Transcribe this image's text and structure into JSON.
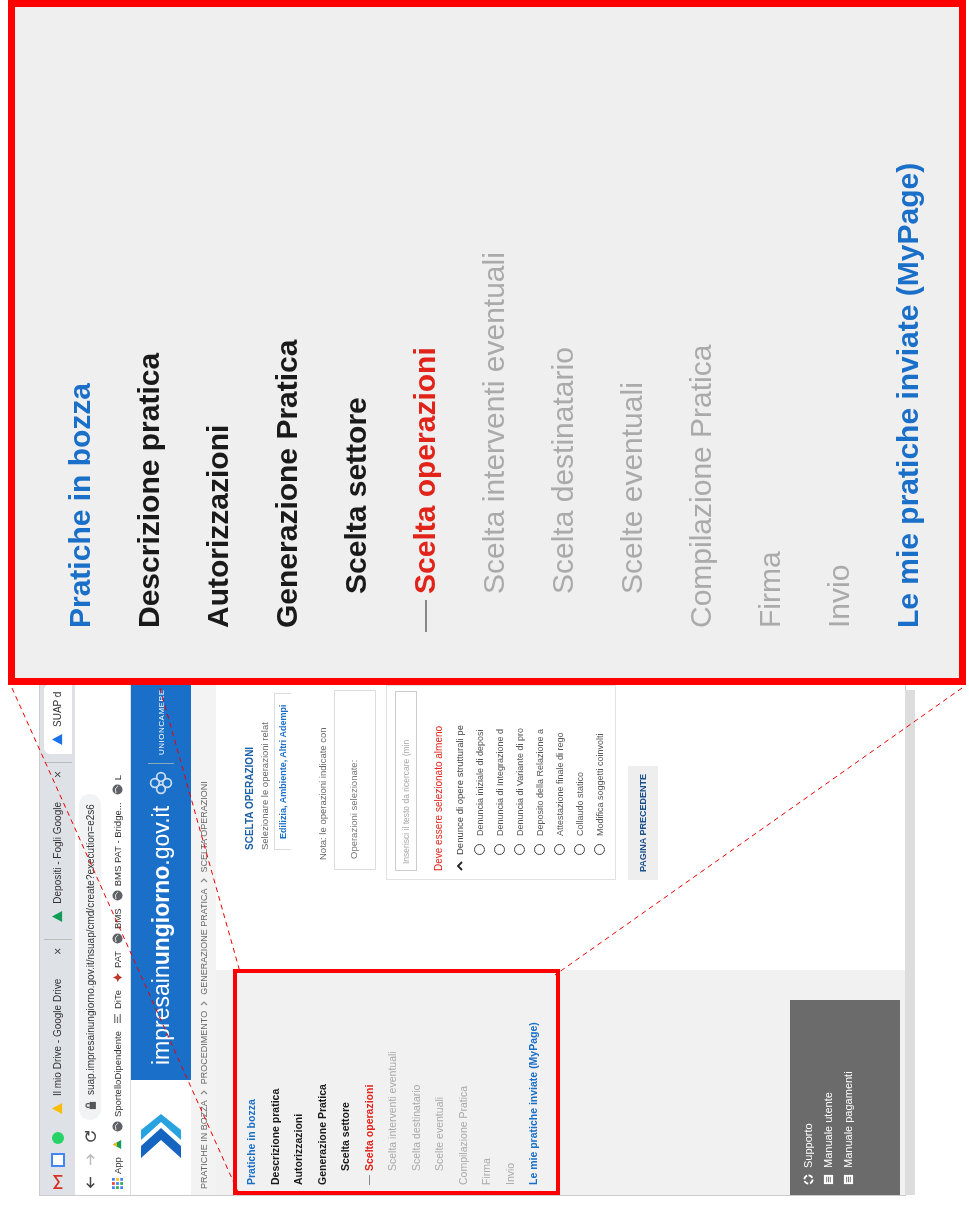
{
  "browser": {
    "tabs": [
      {
        "title": "Il mio Drive - Google Drive",
        "close": "×",
        "selected": false
      },
      {
        "title": "Depositi - Fogli Google",
        "close": "×",
        "selected": false
      },
      {
        "title": "SUAP d",
        "selected": true
      }
    ],
    "address": "suap.impresainungiorno.gov.it/nsuap/cmd/create?execution=e2s6",
    "bookmarks": [
      {
        "label": "App",
        "kind": "apps"
      },
      {
        "kind": "drive"
      },
      {
        "label": "SportelloDipendente",
        "kind": "globe"
      },
      {
        "label": "DiTe",
        "kind": "lines"
      },
      {
        "label": "PAT",
        "kind": "pat"
      },
      {
        "label": "BMS",
        "kind": "globe"
      },
      {
        "label": "BMS PAT - Bridge...",
        "kind": "globe"
      },
      {
        "label": "L",
        "kind": "globe"
      }
    ]
  },
  "header": {
    "site_name": "impresain**ungiorno**.gov.it",
    "partner": "UNIONCAMERE"
  },
  "breadcrumb": [
    "PRATICHE IN BOZZA",
    "PROCEDIMENTO",
    "GENERAZIONE PRATICA",
    "SCELTA OPERAZIONI"
  ],
  "sidebar": {
    "items": [
      {
        "label": "Pratiche in bozza",
        "kind": "link"
      },
      {
        "label": "Descrizione pratica",
        "kind": "step",
        "selected": false,
        "disabled": false
      },
      {
        "label": "Autorizzazioni",
        "kind": "step",
        "selected": false,
        "disabled": false
      },
      {
        "label": "Generazione Pratica",
        "kind": "step",
        "selected": false,
        "disabled": false,
        "children": [
          {
            "label": "Scelta settore",
            "kind": "step",
            "selected": false,
            "disabled": false
          },
          {
            "label": "Scelta operazioni",
            "kind": "step",
            "selected": true,
            "disabled": false
          },
          {
            "label": "Scelta interventi eventuali",
            "kind": "step",
            "selected": false,
            "disabled": true
          },
          {
            "label": "Scelta destinatario",
            "kind": "step",
            "selected": false,
            "disabled": true
          },
          {
            "label": "Scelte eventuali",
            "kind": "step",
            "selected": false,
            "disabled": true
          }
        ]
      },
      {
        "label": "Compilazione Pratica",
        "kind": "step",
        "selected": false,
        "disabled": true
      },
      {
        "label": "Firma",
        "kind": "step",
        "selected": false,
        "disabled": true
      },
      {
        "label": "Invio",
        "kind": "step",
        "selected": false,
        "disabled": true
      },
      {
        "label": "Le mie pratiche inviate (MyPage)",
        "kind": "link"
      }
    ],
    "footer": [
      {
        "label": "Supporto",
        "kind": "support"
      },
      {
        "label": "Manuale utente",
        "kind": "manual"
      },
      {
        "label": "Manuale pagamenti",
        "kind": "manual"
      }
    ]
  },
  "main": {
    "title": "SCELTA OPERAZIONI",
    "intro": "Selezionare le operazioni relat",
    "sectors": "Edilizia, Ambiente, Altri Adempi",
    "note": "Nota: le operazioni indicate con",
    "selected_label": "Operazioni selezionate:",
    "search": {
      "placeholder": "Inserisci il testo da ricercare (min"
    },
    "error": "Deve essere selezionato almeno",
    "group": {
      "label": "Denunce di opere strutturali pe",
      "expanded": true,
      "options": [
        {
          "label": "Denuncia iniziale di deposi",
          "selected": false
        },
        {
          "label": "Denuncia di Integrazione d",
          "selected": false
        },
        {
          "label": "Denuncia di Variante di pro",
          "selected": false
        },
        {
          "label": "Deposito della Relazione a",
          "selected": false
        },
        {
          "label": "Attestazione finale di rego",
          "selected": false
        },
        {
          "label": "Collaudo statico",
          "selected": false
        },
        {
          "label": "Modifica soggetti coinvolti",
          "selected": false
        }
      ]
    },
    "back_button": "PAGINA PRECEDENTE"
  },
  "zoom_callout": {
    "items": [
      {
        "label": "Pratiche in bozza",
        "kind": "link"
      },
      {
        "label": "Descrizione pratica",
        "kind": "step",
        "selected": false,
        "disabled": false
      },
      {
        "label": "Autorizzazioni",
        "kind": "step",
        "selected": false,
        "disabled": false
      },
      {
        "label": "Generazione Pratica",
        "kind": "step",
        "selected": false,
        "disabled": false,
        "children": [
          {
            "label": "Scelta settore",
            "kind": "step",
            "selected": false,
            "disabled": false
          },
          {
            "label": "Scelta operazioni",
            "kind": "step",
            "selected": true,
            "disabled": false
          },
          {
            "label": "Scelta interventi eventuali",
            "kind": "step",
            "selected": false,
            "disabled": true
          },
          {
            "label": "Scelta destinatario",
            "kind": "step",
            "selected": false,
            "disabled": true
          },
          {
            "label": "Scelte eventuali",
            "kind": "step",
            "selected": false,
            "disabled": true
          }
        ]
      },
      {
        "label": "Compilazione Pratica",
        "kind": "step",
        "selected": false,
        "disabled": true
      },
      {
        "label": "Firma",
        "kind": "step",
        "selected": false,
        "disabled": true
      },
      {
        "label": "Invio",
        "kind": "step",
        "selected": false,
        "disabled": true
      },
      {
        "label": "Le mie pratiche inviate (MyPage)",
        "kind": "link"
      }
    ]
  }
}
